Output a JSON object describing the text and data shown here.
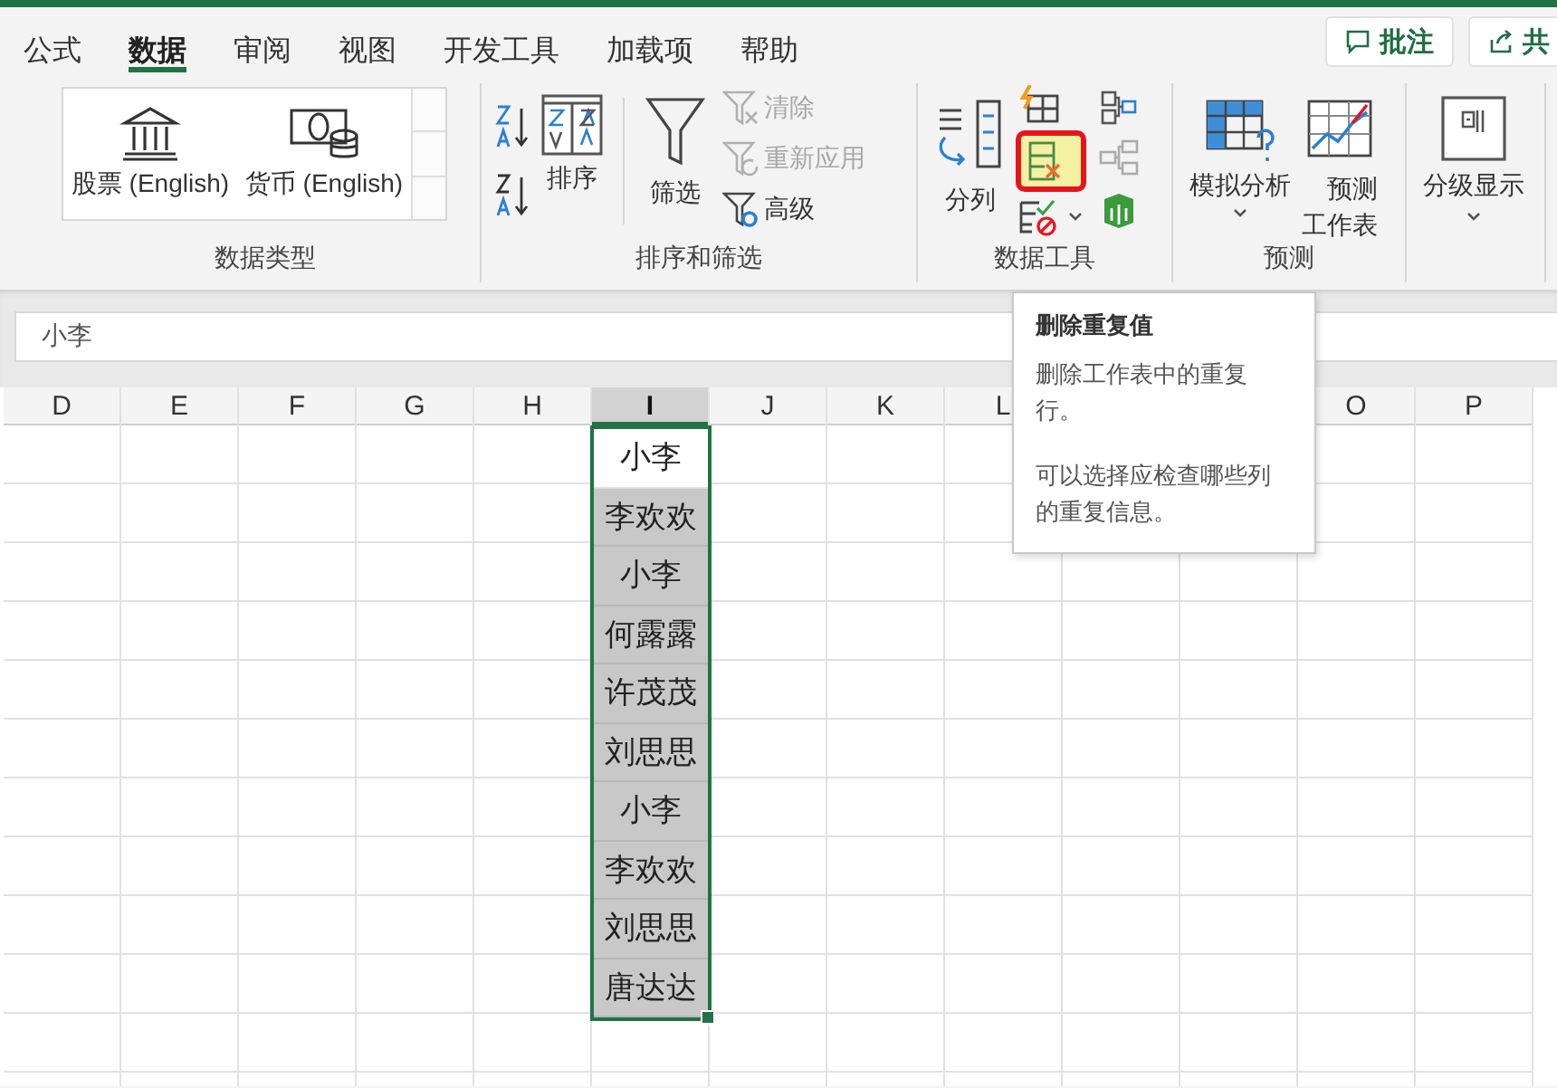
{
  "tabs": [
    {
      "label": "公式",
      "selected": false
    },
    {
      "label": "数据",
      "selected": true
    },
    {
      "label": "审阅",
      "selected": false
    },
    {
      "label": "视图",
      "selected": false
    },
    {
      "label": "开发工具",
      "selected": false
    },
    {
      "label": "加载项",
      "selected": false
    },
    {
      "label": "帮助",
      "selected": false
    }
  ],
  "header_buttons": [
    {
      "label": "批注"
    },
    {
      "label": "共"
    }
  ],
  "ribbon": {
    "groups": [
      {
        "kind": "gallery",
        "label": "数据类型",
        "items": [
          "股票 (English)",
          "货币 (English)"
        ]
      },
      {
        "kind": "sort_filter",
        "label": "排序和筛选",
        "sort_button": "排序",
        "filter_button": "筛选",
        "small_buttons": [
          {
            "label": "清除",
            "disabled": true
          },
          {
            "label": "重新应用",
            "disabled": true
          },
          {
            "label": "高级",
            "disabled": false
          }
        ]
      },
      {
        "kind": "data_tools",
        "label": "数据工具",
        "split_button": "分列",
        "remove_duplicates": {
          "highlighted": true
        }
      },
      {
        "kind": "forecast",
        "label": "预测",
        "buttons": [
          "模拟分析",
          "预测工作表"
        ]
      },
      {
        "kind": "outline",
        "buttons": [
          "分级显示"
        ]
      }
    ]
  },
  "formula_bar": {
    "value": "小李"
  },
  "sheet": {
    "columns": [
      {
        "kind": "header",
        "label": "D",
        "selected": false
      },
      {
        "kind": "header",
        "label": "E",
        "selected": false
      },
      {
        "kind": "header",
        "label": "F",
        "selected": false
      },
      {
        "kind": "header",
        "label": "G",
        "selected": false
      },
      {
        "kind": "header",
        "label": "H",
        "selected": false
      },
      {
        "kind": "header",
        "label": "I",
        "selected": true,
        "cells": [
          {
            "text": "小李",
            "active": true
          },
          {
            "text": "李欢欢",
            "active": false
          },
          {
            "text": "小李",
            "active": false
          },
          {
            "text": "何露露",
            "active": false
          },
          {
            "text": "许茂茂",
            "active": false
          },
          {
            "text": "刘思思",
            "active": false
          },
          {
            "text": "小李",
            "active": false
          },
          {
            "text": "李欢欢",
            "active": false
          },
          {
            "text": "刘思思",
            "active": false
          },
          {
            "text": "唐达达",
            "active": false
          }
        ]
      },
      {
        "kind": "header",
        "label": "J",
        "selected": false
      },
      {
        "kind": "header",
        "label": "K",
        "selected": false
      },
      {
        "kind": "header",
        "label": "L",
        "selected": false
      },
      {
        "kind": "covered"
      },
      {
        "kind": "covered"
      },
      {
        "kind": "header",
        "label": "O",
        "selected": false
      },
      {
        "kind": "header",
        "label": "P",
        "selected": false
      }
    ]
  },
  "tooltip": {
    "title": "删除重复值",
    "paragraphs": [
      "删除工作表中的重复行。",
      "可以选择应检查哪些列的重复信息。"
    ]
  }
}
